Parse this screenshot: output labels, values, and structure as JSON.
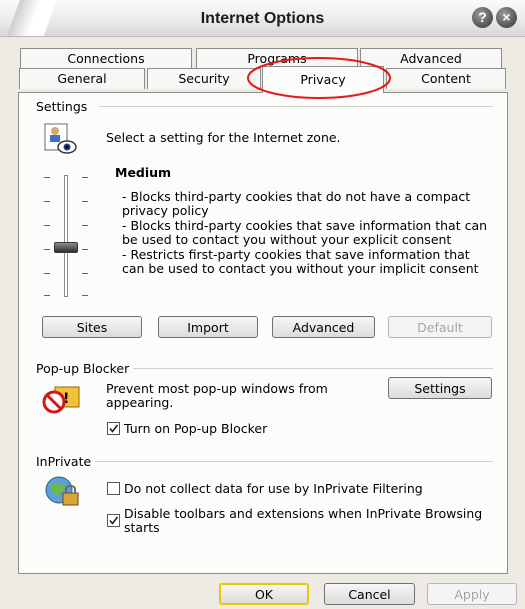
{
  "window": {
    "title": "Internet Options"
  },
  "tabs": {
    "row1": [
      "Connections",
      "Programs",
      "Advanced"
    ],
    "row2": [
      "General",
      "Security",
      "Privacy",
      "Content"
    ],
    "selected": "Privacy"
  },
  "settings": {
    "group_label": "Settings",
    "zone_text": "Select a setting for the Internet zone.",
    "level_title": "Medium",
    "level": "Medium",
    "bullets": [
      "- Blocks third-party cookies that do not have a compact privacy policy",
      "- Blocks third-party cookies that save information that can be used to contact you without your explicit consent",
      "- Restricts first-party cookies that save information that can be used to contact you without your implicit consent"
    ],
    "buttons": {
      "sites": "Sites",
      "import": "Import",
      "advanced": "Advanced",
      "default": "Default"
    }
  },
  "popup": {
    "group_label": "Pop-up Blocker",
    "description": "Prevent most pop-up windows from appearing.",
    "settings_button": "Settings",
    "checkbox_label": "Turn on Pop-up Blocker",
    "checkbox_checked": true
  },
  "inprivate": {
    "group_label": "InPrivate",
    "opt1_label": "Do not collect data for use by InPrivate Filtering",
    "opt1_checked": false,
    "opt2_label": "Disable toolbars and extensions when InPrivate Browsing starts",
    "opt2_checked": true
  },
  "footer": {
    "ok": "OK",
    "cancel": "Cancel",
    "apply": "Apply"
  },
  "annotation": {
    "shape": "red-ellipse",
    "color": "#e31c1c",
    "target": "Privacy"
  },
  "colors": {
    "dialog_bg": "#eceae2",
    "panel_bg": "#fcfcfb",
    "default_button_border": "#e8c900"
  }
}
